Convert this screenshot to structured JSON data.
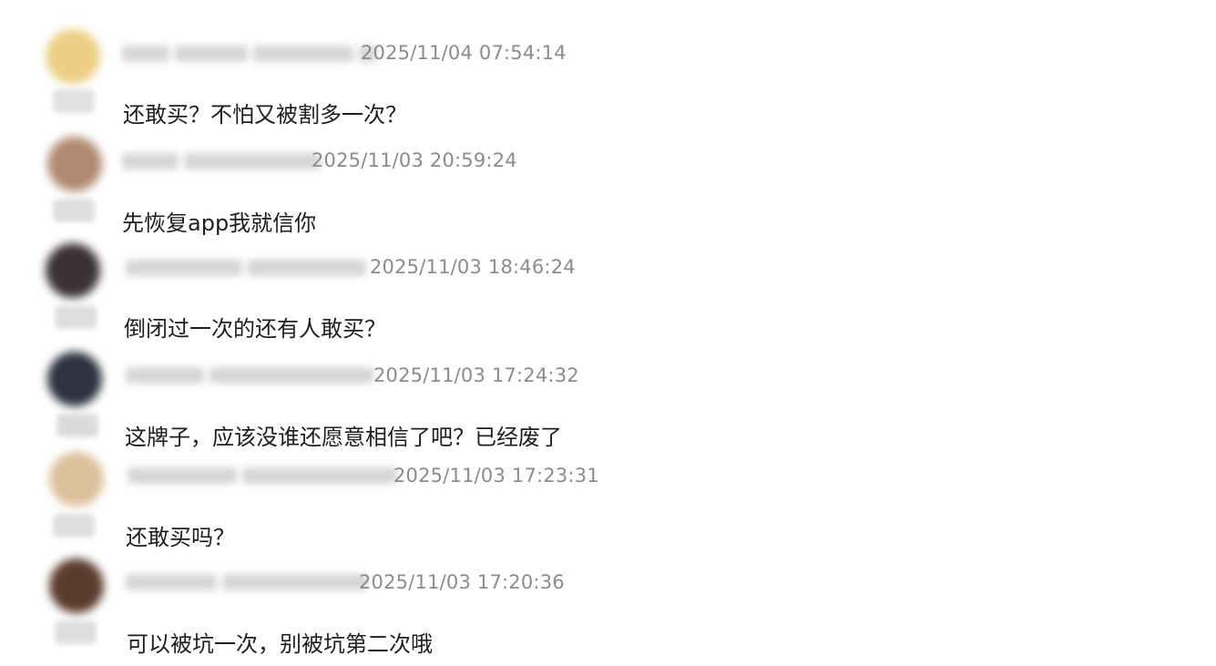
{
  "comments": [
    {
      "timestamp": "2025/11/04 07:54:14",
      "text": "还敢买？不怕又被割多一次？",
      "avatar_color": "#eccf84",
      "badge_color": "#d9d9d9"
    },
    {
      "timestamp": "2025/11/03 20:59:24",
      "text": "先恢复app我就信你",
      "avatar_color": "#b08a72",
      "badge_color": "#d6d6d6"
    },
    {
      "timestamp": "2025/11/03 18:46:24",
      "text": "倒闭过一次的还有人敢买？",
      "avatar_color": "#3c3236",
      "badge_color": "#d6d6d6"
    },
    {
      "timestamp": "2025/11/03 17:24:32",
      "text": "这牌子，应该没谁还愿意相信了吧？已经废了",
      "avatar_color": "#2d3340",
      "badge_color": "#d3d3d3"
    },
    {
      "timestamp": "2025/11/03 17:23:31",
      "text": "还敢买吗？",
      "avatar_color": "#dcc09c",
      "badge_color": "#d6d6d6"
    },
    {
      "timestamp": "2025/11/03 17:20:36",
      "text": "可以被坑一次，别被坑第二次哦",
      "avatar_color": "#5b3c2c",
      "badge_color": "#d6d6d6"
    }
  ]
}
